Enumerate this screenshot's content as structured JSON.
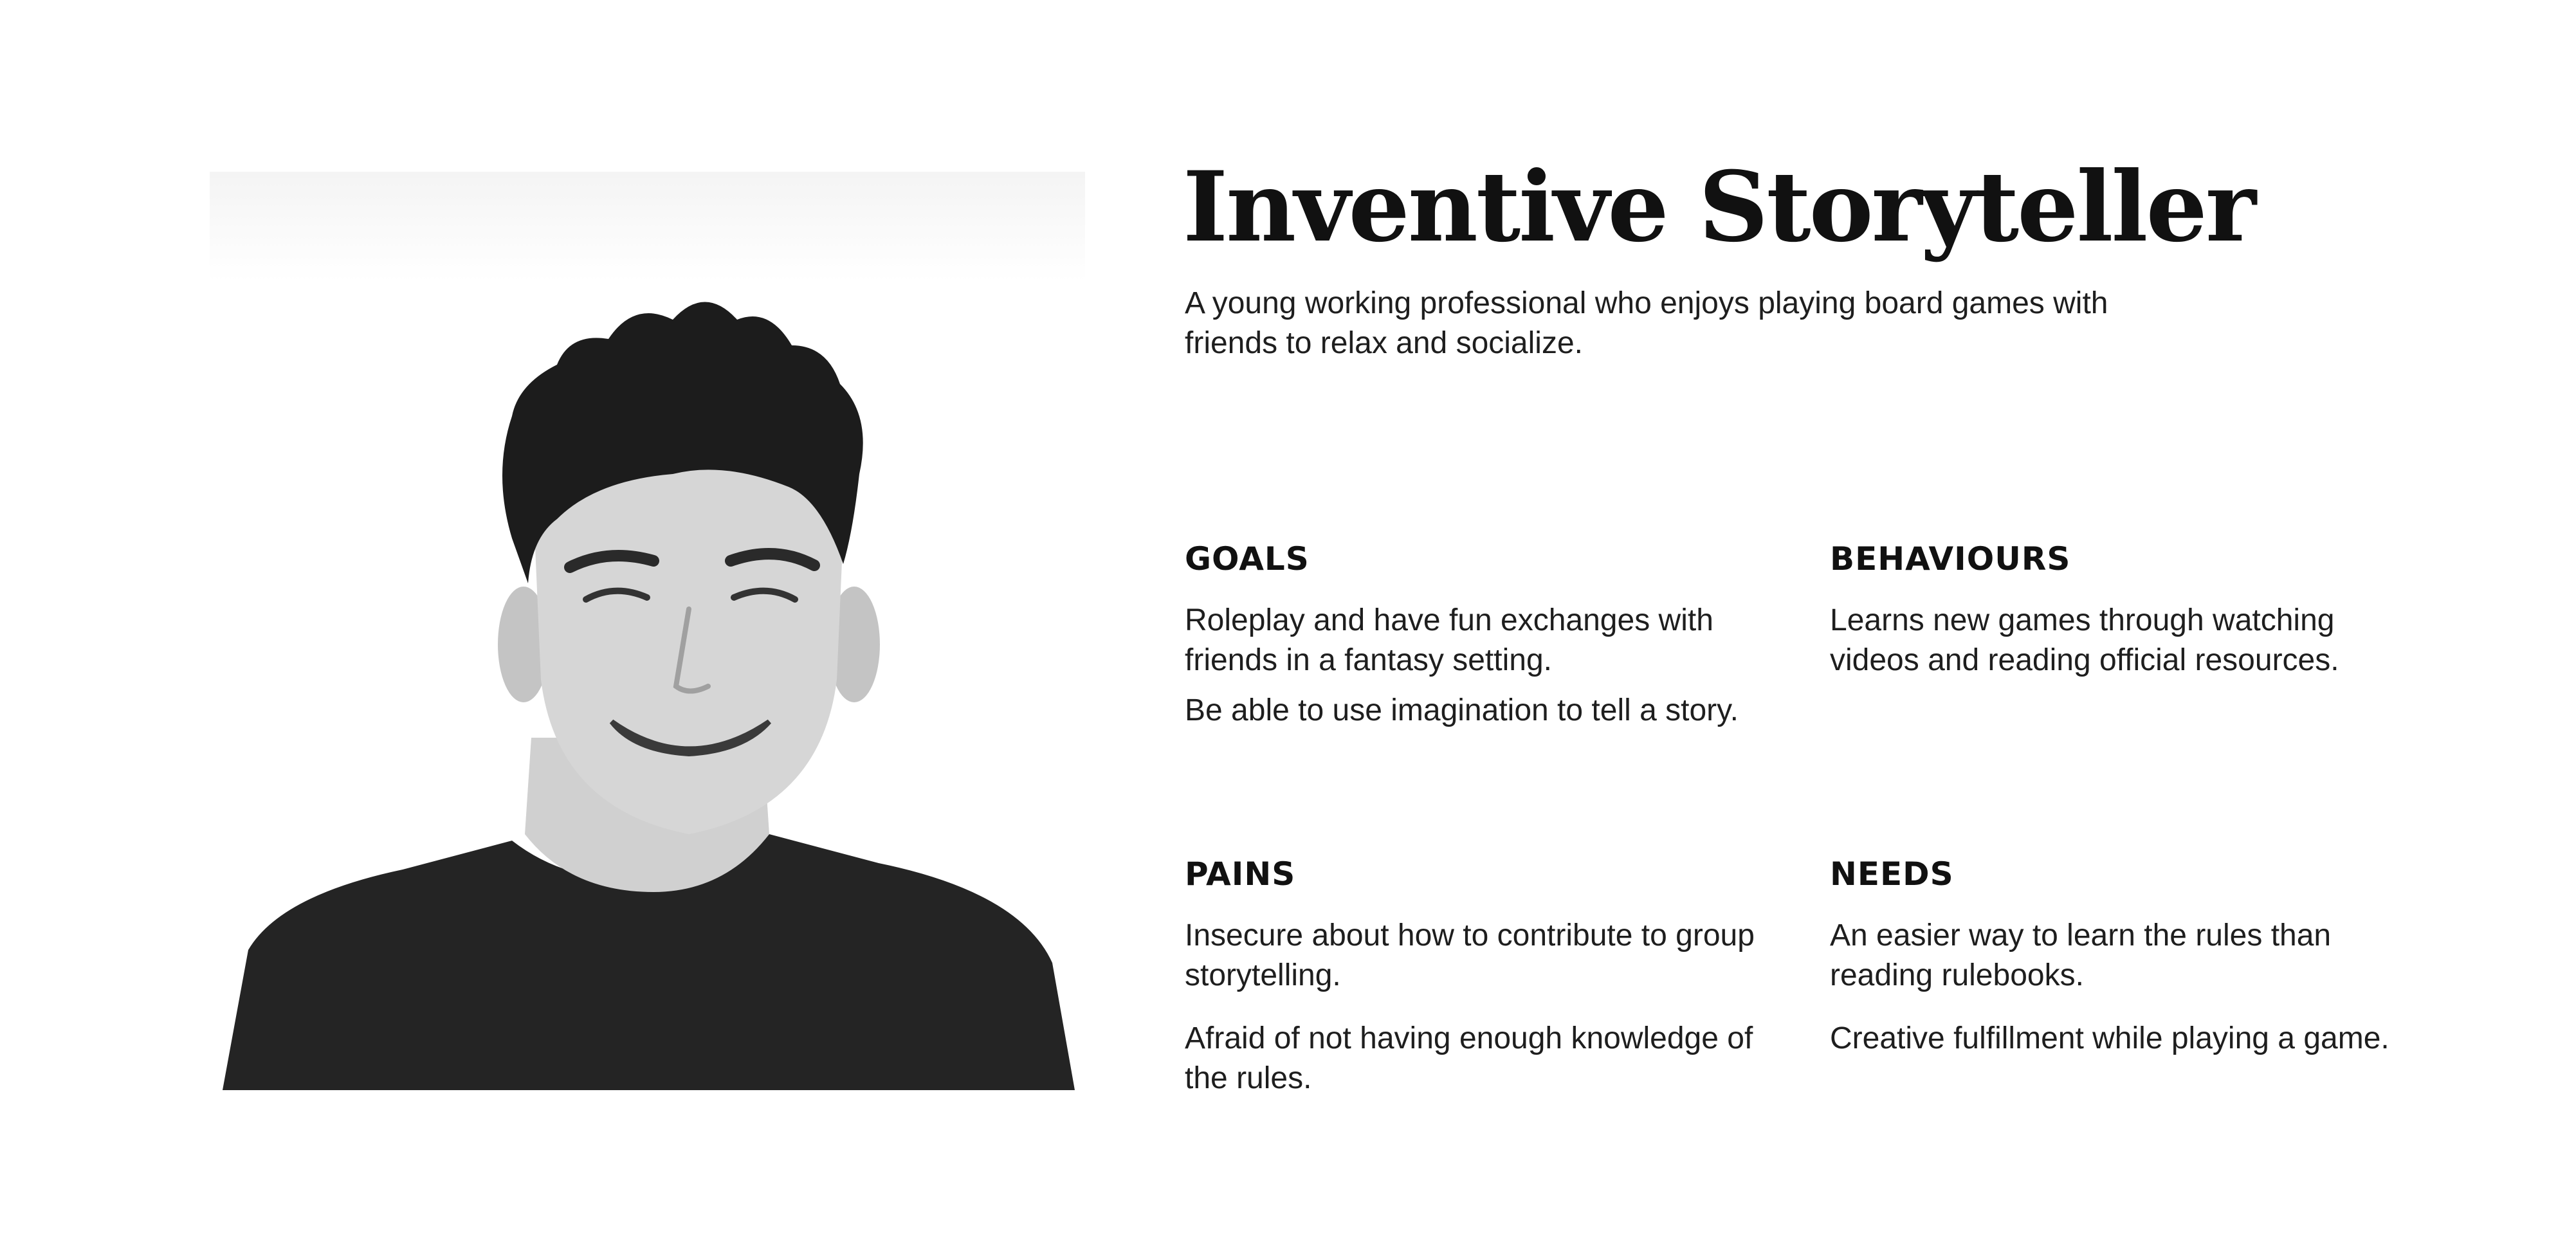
{
  "persona": {
    "title": "Inventive Storyteller",
    "subtitle": "A young working professional who enjoys playing board games with friends to relax and socialize."
  },
  "sections": {
    "goals": {
      "heading": "GOALS",
      "items": [
        "Roleplay and have fun exchanges with friends in a fantasy setting.",
        "Be able to use imagination to tell a story."
      ]
    },
    "behaviours": {
      "heading": "BEHAVIOURS",
      "items": [
        "Learns new games through watching videos and reading official resources."
      ]
    },
    "pains": {
      "heading": "PAINS",
      "items": [
        "Insecure about how to contribute to group storytelling.",
        "Afraid of not having enough knowledge of the rules."
      ]
    },
    "needs": {
      "heading": "NEEDS",
      "items": [
        "An easier way to learn the rules than reading rulebooks.",
        "Creative fulfillment while playing a game."
      ]
    }
  },
  "colors": {
    "background": "#ffffff",
    "text": "#1a1a1a"
  }
}
